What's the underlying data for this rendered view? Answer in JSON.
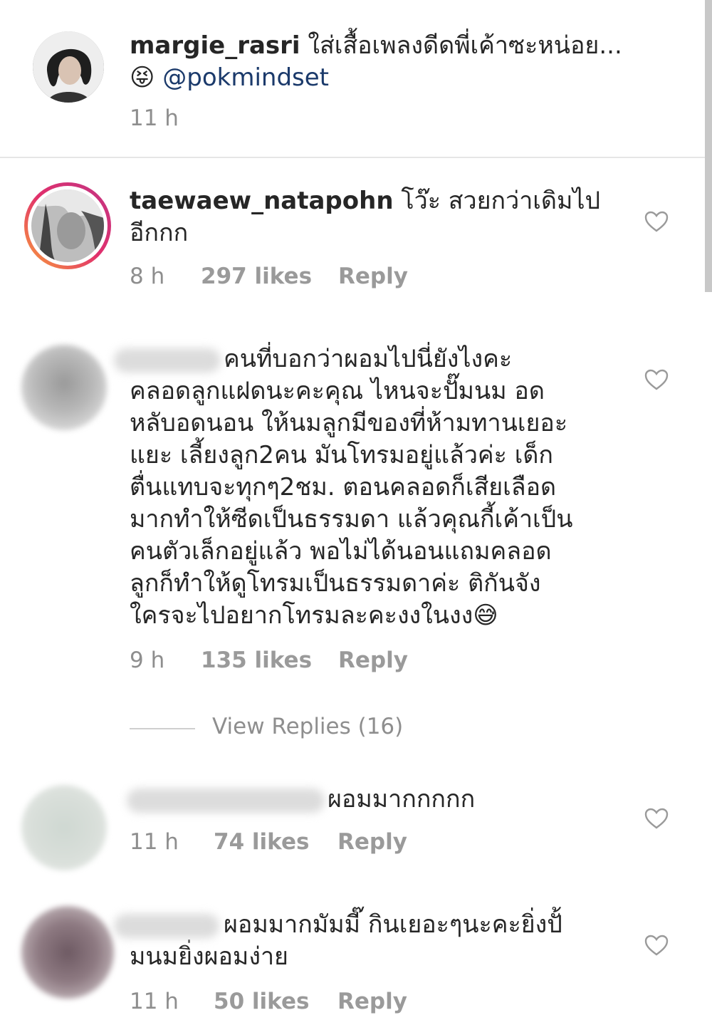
{
  "caption": {
    "username": "margie_rasri",
    "text": " ใส่เสื้อเพลงดีดพี่เค้าซะหน่อย...",
    "emoji": "😝",
    "mention": "@pokmindset",
    "time": "11 h"
  },
  "comments": [
    {
      "username": "taewaew_natapohn",
      "text_line1": " โว๊ะ สวยกว่าเดิมไป",
      "text_line2": "อีกกก",
      "time": "8 h",
      "likes": "297 likes",
      "reply": "Reply"
    },
    {
      "lines": [
        "คนที่บอกว่าผอมไปนี่ยังไงคะ",
        "คลอดลูกแฝดนะคะคุณ ไหนจะปั๊มนม อด",
        "หลับอดนอน ให้นมลูกมีของที่ห้ามทานเยอะ",
        "แยะ เลี้ยงลูก2คน มันโทรมอยู่แล้วค่ะ เด็ก",
        "ตื่นแทบจะทุกๆ2ชม. ตอนคลอดก็เสียเลือด",
        "มากทำให้ซีดเป็นธรรมดา แล้วคุณกี้เค้าเป็น",
        "คนตัวเล็กอยู่แล้ว พอไม่ได้นอนแถมคลอด",
        "ลูกก็ทำให้ดูโทรมเป็นธรรมดาค่ะ ติกันจัง",
        "ใครจะไปอยากโทรมละคะงงในงง"
      ],
      "emoji": "😅",
      "time": "9 h",
      "likes": "135 likes",
      "reply": "Reply",
      "view_replies": "View Replies (16)"
    },
    {
      "text": "ผอมมากกกกก",
      "time": "11 h",
      "likes": "74 likes",
      "reply": "Reply"
    },
    {
      "text_line1": "ผอมมากมัมมี๊ กินเยอะๆนะคะยิ่งปั้",
      "text_line2": "มนมยิ่งผอมง่าย",
      "time": "11 h",
      "likes": "50 likes",
      "reply": "Reply"
    }
  ],
  "icons": {
    "like": "heart-outline-icon"
  },
  "colors": {
    "mention": "#1b3a6b",
    "muted": "#8e8e8e",
    "story_ring_start": "#f9a13a",
    "story_ring_end": "#c13584"
  }
}
